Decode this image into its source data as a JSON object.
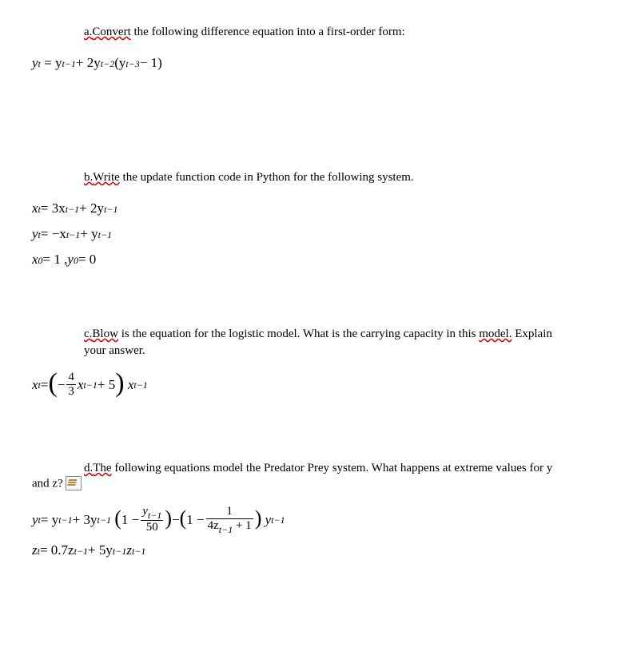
{
  "a": {
    "label": "a.",
    "underlined": "Convert",
    "rest": " the following difference equation into a first-order form:",
    "eq_lhs": "y",
    "eq": "= y",
    "eq2": " + 2y",
    "eq3": "(y",
    "eq4": " − 1)",
    "sub_t": "t",
    "sub_t1": "t−1",
    "sub_t2": "t−2",
    "sub_t3": "t−3"
  },
  "b": {
    "label": "b.",
    "underlined": "Write",
    "rest": " the update function code in Python for the following system.",
    "l1_lhs": "x",
    "l1_eq": " = 3x",
    "l1_mid": " + 2y",
    "l2_lhs": "y",
    "l2_eq": " = −x",
    "l2_mid": " + y",
    "l3_x": "x",
    "l3_xeq": " = 1   ,   ",
    "l3_y": "y",
    "l3_yeq": " = 0",
    "sub_t": "t",
    "sub_t1": "t−1",
    "sub_0": "0"
  },
  "c": {
    "label": "c.",
    "underlined": "Blow",
    "rest1": " is the equation for the logistic model. What is the carrying capacity in this ",
    "underlined2": "model.",
    "rest2": " Explain",
    "line2": "your answer.",
    "lhs": "x",
    "eq": " = ",
    "frac_num": "4",
    "frac_den": "3",
    "mid": " + 5",
    "sub_t": "t",
    "sub_t1": "t−1",
    "minus": "−",
    "xvar": "x"
  },
  "d": {
    "label": "d.",
    "underlined": "The",
    "rest": " following equations model the Predator Prey system. What happens at extreme values for y",
    "line2_a": "and z?  ",
    "l1_y": "y",
    "l1_eq": " = y",
    "l1_p3y": " + 3y",
    "l1_one": "1 − ",
    "l1_frac_num_y": "y",
    "l1_frac_den": "50",
    "l1_minus": " − ",
    "l1_one2": "1 − ",
    "l1_frac2_num": "1",
    "l1_frac2_den_a": "4z",
    "l1_frac2_den_b": " + 1",
    "l1_tail": "y",
    "l2_z": "z",
    "l2_eq": " = 0.7z",
    "l2_p5y": " + 5y",
    "l2_tail": "z",
    "sub_t": "t",
    "sub_t1": "t−1"
  }
}
